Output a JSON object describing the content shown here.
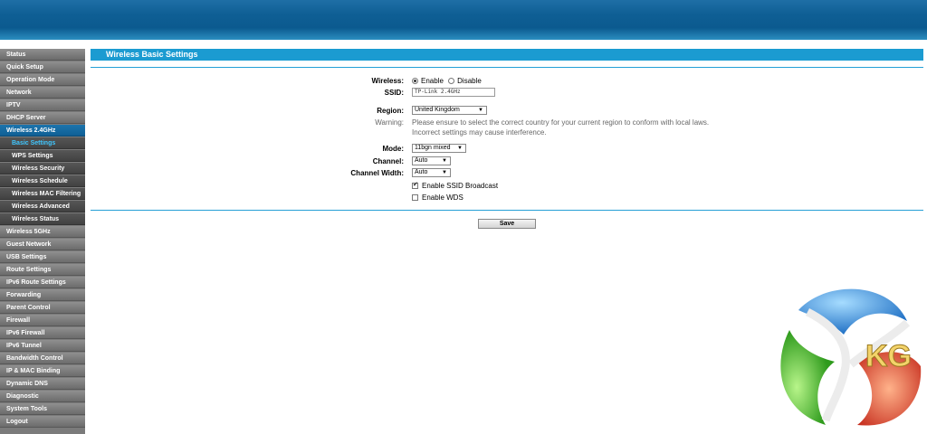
{
  "sidebar": {
    "items": [
      {
        "label": "Status"
      },
      {
        "label": "Quick Setup"
      },
      {
        "label": "Operation Mode"
      },
      {
        "label": "Network"
      },
      {
        "label": "IPTV"
      },
      {
        "label": "DHCP Server"
      },
      {
        "label": "Wireless 2.4GHz"
      },
      {
        "label": "Basic Settings"
      },
      {
        "label": "WPS Settings"
      },
      {
        "label": "Wireless Security"
      },
      {
        "label": "Wireless Schedule"
      },
      {
        "label": "Wireless MAC Filtering"
      },
      {
        "label": "Wireless Advanced"
      },
      {
        "label": "Wireless Status"
      },
      {
        "label": "Wireless 5GHz"
      },
      {
        "label": "Guest Network"
      },
      {
        "label": "USB Settings"
      },
      {
        "label": "Route Settings"
      },
      {
        "label": "IPv6 Route Settings"
      },
      {
        "label": "Forwarding"
      },
      {
        "label": "Parent Control"
      },
      {
        "label": "Firewall"
      },
      {
        "label": "IPv6 Firewall"
      },
      {
        "label": "IPv6 Tunnel"
      },
      {
        "label": "Bandwidth Control"
      },
      {
        "label": "IP & MAC Binding"
      },
      {
        "label": "Dynamic DNS"
      },
      {
        "label": "Diagnostic"
      },
      {
        "label": "System Tools"
      },
      {
        "label": "Logout"
      }
    ]
  },
  "page": {
    "title": "Wireless Basic Settings"
  },
  "form": {
    "wireless_label": "Wireless:",
    "enable_label": "Enable",
    "disable_label": "Disable",
    "ssid_label": "SSID:",
    "ssid_value": "TP-Link 2.4GHz",
    "region_label": "Region:",
    "region_value": "United Kingdom",
    "warning_label": "Warning:",
    "warning_line1": "Please ensure to select the correct country for your current region to conform with local laws.",
    "warning_line2": "Incorrect settings may cause interference.",
    "mode_label": "Mode:",
    "mode_value": "11bgn mixed",
    "channel_label": "Channel:",
    "channel_value": "Auto",
    "channel_width_label": "Channel Width:",
    "channel_width_value": "Auto",
    "ssid_broadcast_label": "Enable SSID Broadcast",
    "wds_label": "Enable WDS",
    "save_label": "Save"
  },
  "watermark": {
    "text": "KG"
  }
}
